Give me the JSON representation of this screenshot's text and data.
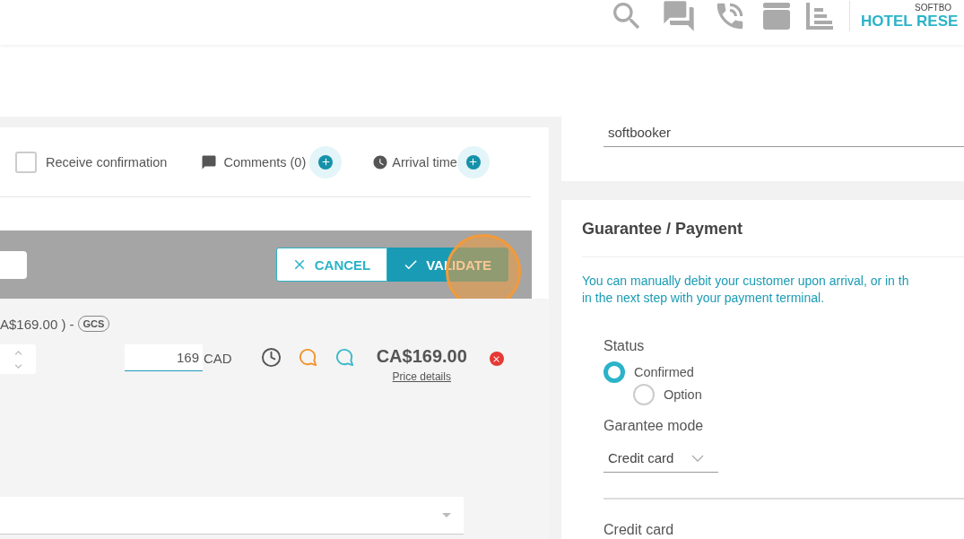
{
  "header": {
    "brand_small": "SOFTBO",
    "brand_title": "HOTEL RESE"
  },
  "options_bar": {
    "receive_confirmation": {
      "label": "Receive confirmation",
      "checked": false
    },
    "comments": {
      "label": "Comments (0)"
    },
    "arrival_time": {
      "label": "Arrival time"
    }
  },
  "action_bar": {
    "buttons": [
      {
        "label": "CANCEL",
        "kind": "outline"
      },
      {
        "label": "VALIDATE",
        "kind": "primary"
      }
    ]
  },
  "room_line": {
    "rate_text": "A$169.00 ) -",
    "badge": "GCS",
    "price_value": "169",
    "currency": "CAD",
    "total": "CA$169.00",
    "price_details": "Price details"
  },
  "contact": {
    "value": "softbooker"
  },
  "guarantee": {
    "title": "Guarantee / Payment",
    "info_lines": [
      "You can manually debit your customer upon arrival, or in th",
      "in the next step with your payment terminal."
    ],
    "status_label": "Status",
    "status_options": [
      {
        "label": "Confirmed",
        "selected": true
      },
      {
        "label": "Option",
        "selected": false
      }
    ],
    "mode_label": "Garantee mode",
    "mode_value": "Credit card",
    "card_label": "Credit card"
  }
}
